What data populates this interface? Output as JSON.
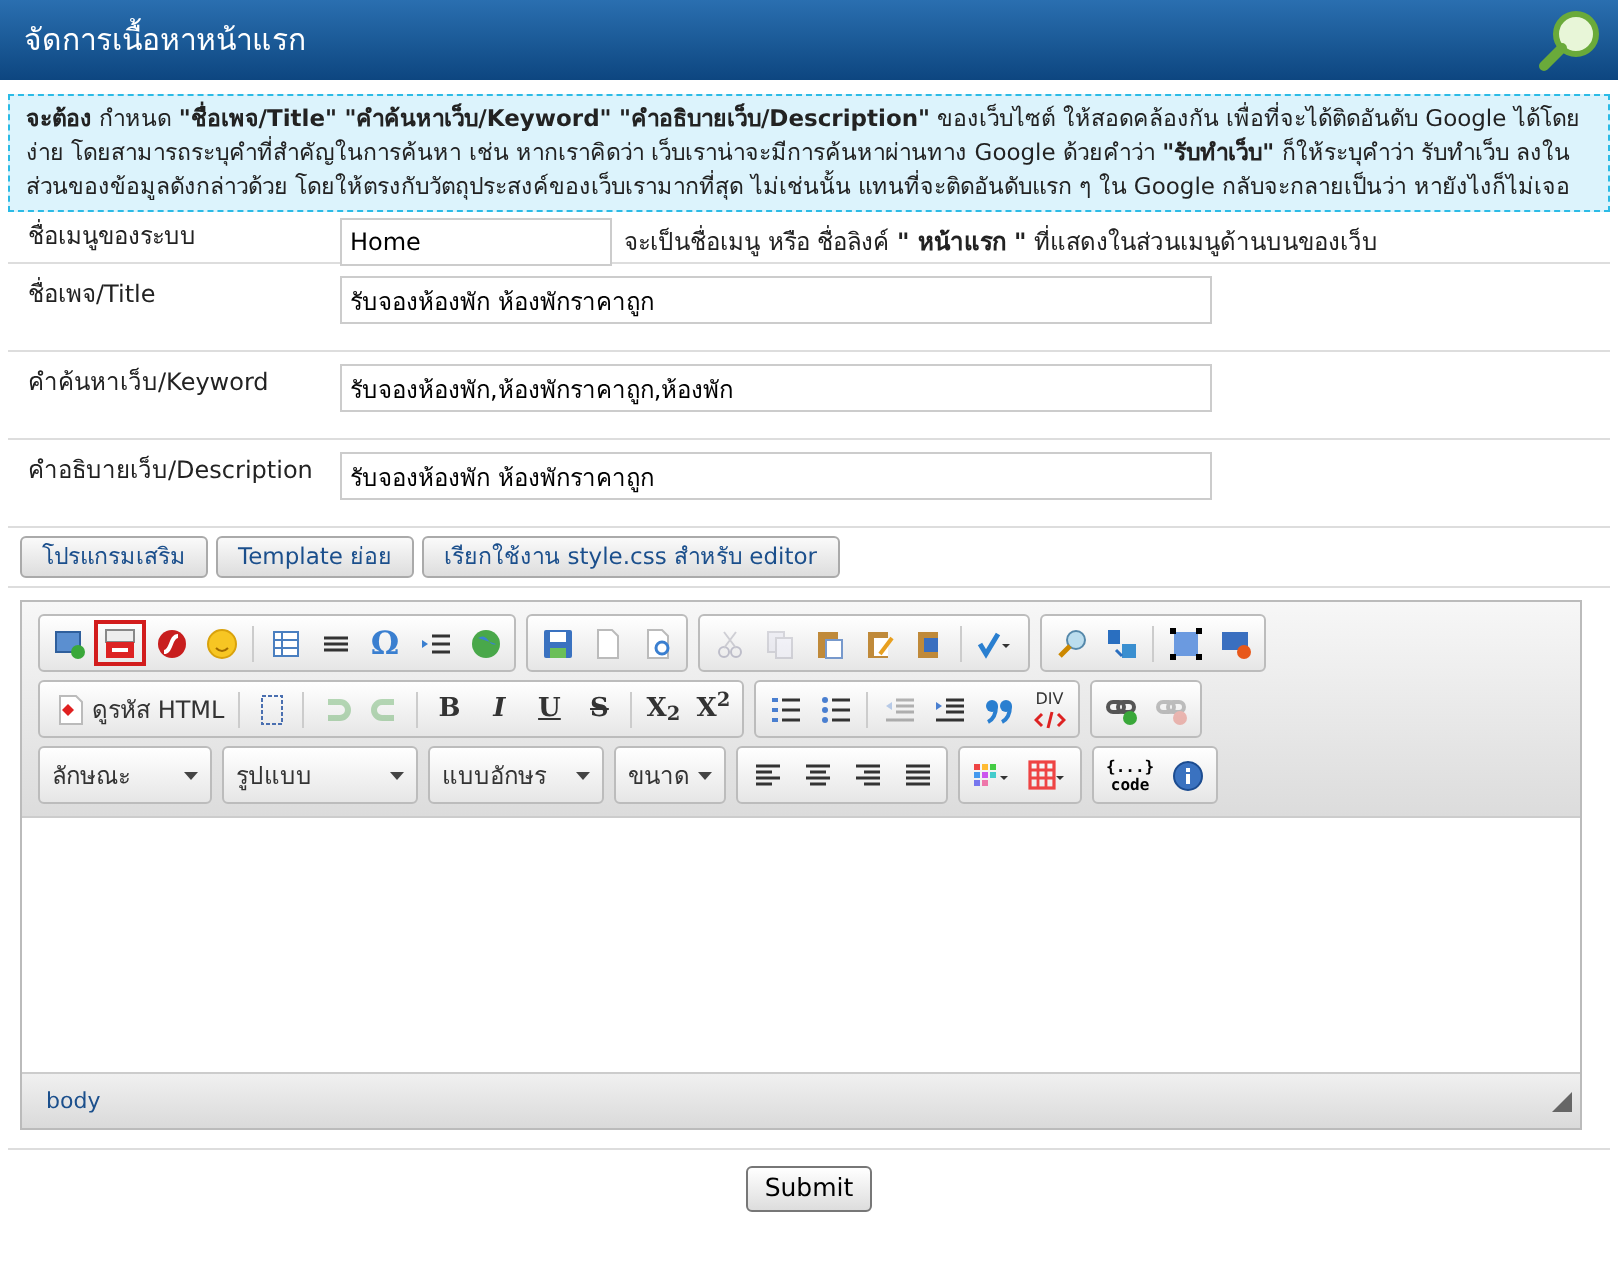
{
  "header": {
    "title": "จัดการเนื้อหาหน้าแรก"
  },
  "notice": "**จะต้อง** กำหนด **\"ชื่อเพจ/Title\"** **\"คำค้นหาเว็บ/Keyword\"** **\"คำอธิบายเว็บ/Description\"** ของเว็บไซต์ ให้สอดคล้องกัน เพื่อที่จะได้ติดอันดับ Google ได้โดยง่าย โดยสามารถระบุคำที่สำคัญในการค้นหา เช่น หากเราคิดว่า เว็บเราน่าจะมีการค้นหาผ่านทาง Google ด้วยคำว่า **\"รับทำเว็บ\"** ก็ให้ระบุคำว่า รับทำเว็บ ลงในส่วนของข้อมูลดังกล่าวด้วย โดยให้ตรงกับวัตถุประสงค์ของเว็บเรามากที่สุด ไม่เช่นนั้น แทนที่จะติดอันดับแรก ๆ ใน Google กลับจะกลายเป็นว่า หายังไงก็ไม่เจอ",
  "fields": [
    {
      "kind": "short",
      "label": "ชื่อเมนูของระบบ",
      "value": "Home",
      "hint": "จะเป็นชื่อเมนู หรือ ชื่อลิงค์ **\" หน้าแรก \"** ที่แสดงในส่วนเมนูด้านบนของเว็บ"
    },
    {
      "kind": "long",
      "label": "ชื่อเพจ/Title",
      "value": "รับจองห้องพัก ห้องพักราคาถูก"
    },
    {
      "kind": "long",
      "label": "คำค้นหาเว็บ/Keyword",
      "value": "รับจองห้องพัก,ห้องพักราคาถูก,ห้องพัก"
    },
    {
      "kind": "long",
      "label": "คำอธิบายเว็บ/Description",
      "value": "รับจองห้องพัก ห้องพักราคาถูก"
    }
  ],
  "tool_tabs": [
    "โปรแกรมเสริม",
    "Template ย่อย",
    "เรียกใช้งาน style.css สำหรับ editor"
  ],
  "editor": {
    "toolbar": [
      [
        [
          {
            "kind": "button",
            "disabled": false,
            "highlighted": false
          },
          {
            "kind": "button",
            "disabled": false,
            "highlighted": true
          },
          {
            "kind": "button",
            "disabled": false,
            "highlighted": false
          },
          {
            "kind": "button",
            "disabled": false,
            "highlighted": false
          },
          {
            "kind": "separator"
          },
          {
            "kind": "button",
            "disabled": false,
            "highlighted": false
          },
          {
            "kind": "button",
            "disabled": false,
            "highlighted": false
          },
          {
            "kind": "button",
            "disabled": false,
            "highlighted": false,
            "label": "Ω"
          },
          {
            "kind": "button",
            "disabled": false,
            "highlighted": false
          },
          {
            "kind": "button",
            "disabled": false,
            "highlighted": false
          }
        ],
        [
          {
            "kind": "button",
            "disabled": false,
            "highlighted": false
          },
          {
            "kind": "button",
            "disabled": false,
            "highlighted": false
          },
          {
            "kind": "button",
            "disabled": false,
            "highlighted": false
          }
        ],
        [
          {
            "kind": "button",
            "disabled": true,
            "highlighted": false
          },
          {
            "kind": "button",
            "disabled": true,
            "highlighted": false
          },
          {
            "kind": "button",
            "disabled": false,
            "highlighted": false
          },
          {
            "kind": "button",
            "disabled": false,
            "highlighted": false
          },
          {
            "kind": "button",
            "disabled": false,
            "highlighted": false
          },
          {
            "kind": "separator"
          },
          {
            "kind": "dropdown",
            "disabled": false,
            "highlighted": false
          }
        ],
        [
          {
            "kind": "button",
            "disabled": false,
            "highlighted": false
          },
          {
            "kind": "button",
            "disabled": false,
            "highlighted": false
          },
          {
            "kind": "separator"
          },
          {
            "kind": "button",
            "disabled": false,
            "highlighted": false
          },
          {
            "kind": "button",
            "disabled": false,
            "highlighted": false
          }
        ]
      ],
      [
        [
          {
            "kind": "text-button",
            "disabled": false,
            "highlighted": false,
            "label": "ดูรหัส HTML"
          },
          {
            "kind": "separator"
          },
          {
            "kind": "button",
            "disabled": false,
            "highlighted": false
          },
          {
            "kind": "separator"
          },
          {
            "kind": "button",
            "disabled": true,
            "highlighted": false
          },
          {
            "kind": "button",
            "disabled": true,
            "highlighted": false
          },
          {
            "kind": "separator"
          },
          {
            "kind": "button",
            "disabled": false,
            "highlighted": false,
            "label": "B"
          },
          {
            "kind": "button",
            "disabled": false,
            "highlighted": false,
            "label": "I"
          },
          {
            "kind": "button",
            "disabled": false,
            "highlighted": false,
            "label": "U"
          },
          {
            "kind": "button",
            "disabled": false,
            "highlighted": false,
            "label": "S"
          },
          {
            "kind": "separator"
          },
          {
            "kind": "button",
            "disabled": false,
            "highlighted": false,
            "label": "X$_{2}$"
          },
          {
            "kind": "button",
            "disabled": false,
            "highlighted": false,
            "label": "X$^{2}$"
          }
        ],
        [
          {
            "kind": "button",
            "disabled": false,
            "highlighted": false
          },
          {
            "kind": "button",
            "disabled": false,
            "highlighted": false
          },
          {
            "kind": "separator"
          },
          {
            "kind": "button",
            "disabled": true,
            "highlighted": false
          },
          {
            "kind": "button",
            "disabled": false,
            "highlighted": false
          },
          {
            "kind": "button",
            "disabled": false,
            "highlighted": false
          },
          {
            "kind": "button",
            "disabled": false,
            "highlighted": false,
            "label": "DIV"
          }
        ],
        [
          {
            "kind": "button",
            "disabled": false,
            "highlighted": false
          },
          {
            "kind": "button",
            "disabled": true,
            "highlighted": false
          }
        ]
      ],
      [
        [
          {
            "kind": "combo",
            "label": "ลักษณะ"
          }
        ],
        [
          {
            "kind": "combo",
            "label": "รูปแบบ"
          }
        ],
        [
          {
            "kind": "combo",
            "label": "แบบอักษร"
          }
        ],
        [
          {
            "kind": "combo",
            "label": "ขนาด"
          }
        ],
        [
          {
            "kind": "button",
            "disabled": false,
            "highlighted": false
          },
          {
            "kind": "button",
            "disabled": false,
            "highlighted": false
          },
          {
            "kind": "button",
            "disabled": false,
            "highlighted": false
          },
          {
            "kind": "button",
            "disabled": false,
            "highlighted": false
          }
        ],
        [
          {
            "kind": "dropdown",
            "disabled": false,
            "highlighted": false
          },
          {
            "kind": "dropdown",
            "disabled": false,
            "highlighted": false
          }
        ],
        [
          {
            "kind": "button",
            "disabled": false,
            "highlighted": false,
            "label": "{...}",
            "sublabel": "code"
          },
          {
            "kind": "button",
            "disabled": false,
            "highlighted": false
          }
        ]
      ]
    ],
    "path": "body"
  },
  "submit": "Submit"
}
